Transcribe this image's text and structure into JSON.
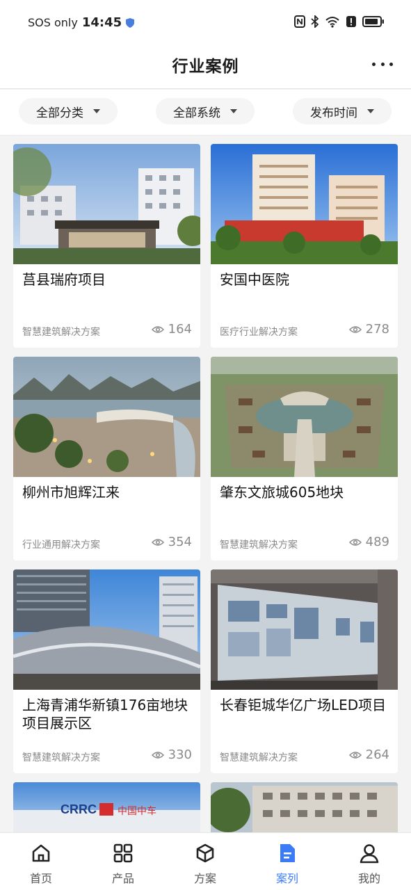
{
  "status_bar": {
    "carrier": "SOS only",
    "time": "14:45"
  },
  "header": {
    "title": "行业案例"
  },
  "filters": [
    {
      "label": "全部分类"
    },
    {
      "label": "全部系统"
    },
    {
      "label": "发布时间"
    }
  ],
  "cases": [
    {
      "name": "莒县瑞府项目",
      "category": "智慧建筑解决方案",
      "views": "164"
    },
    {
      "name": "安国中医院",
      "category": "医疗行业解决方案",
      "views": "278"
    },
    {
      "name": "柳州市旭辉江来",
      "category": "行业通用解决方案",
      "views": "354"
    },
    {
      "name": "肇东文旅城605地块",
      "category": "智慧建筑解决方案",
      "views": "489"
    },
    {
      "name": "上海青浦华新镇176亩地块项目展示区",
      "category": "智慧建筑解决方案",
      "views": "330"
    },
    {
      "name": "长春钜城华亿广场LED项目",
      "category": "智慧建筑解决方案",
      "views": "264"
    }
  ],
  "partial_card_text": {
    "brand": "CRRC",
    "sub": "中国中车"
  },
  "tabbar": {
    "items": [
      {
        "label": "首页",
        "icon": "home-icon"
      },
      {
        "label": "产品",
        "icon": "grid-icon"
      },
      {
        "label": "方案",
        "icon": "cube-icon"
      },
      {
        "label": "案列",
        "icon": "document-icon"
      },
      {
        "label": "我的",
        "icon": "user-icon"
      }
    ],
    "active_index": 3,
    "active_color": "#3b7cf6"
  }
}
